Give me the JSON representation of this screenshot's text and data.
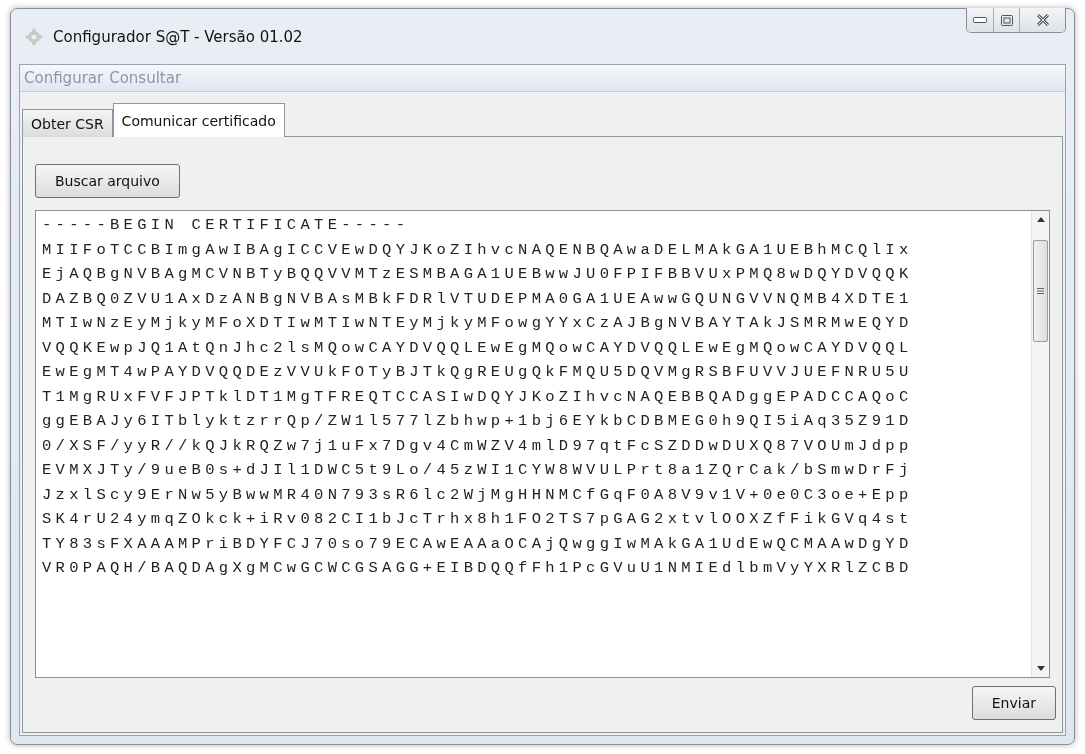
{
  "window": {
    "title": "Configurador S@T - Versão 01.02"
  },
  "menu": [
    {
      "label": "Configurar",
      "disabled": true
    },
    {
      "label": "Consultar",
      "disabled": true
    }
  ],
  "tabs": [
    {
      "label": "Obter CSR",
      "selected": false
    },
    {
      "label": "Comunicar certificado",
      "selected": true
    }
  ],
  "browse_button": "Buscar arquivo",
  "certificate_lines": [
    "-----BEGIN CERTIFICATE-----",
    "MIIFoTCCBImgAwIBAgICCVEwDQYJKoZIhvcNAQENBQAwaDELMAkGA1UEBhMCQlIx",
    "EjAQBgNVBAgMCVNBTyBQQVVMTzESMBAGA1UEBwwJU0FPIFBBVUxPMQ8wDQYDVQQK",
    "DAZBQ0ZVU1AxDzANBgNVBAsMBkFDRlVTUDEPMA0GA1UEAwwGQUNGVVNQMB4XDTE1",
    "MTIwNzEyMjkyMFoXDTIwMTIwNTEyMjkyMFowgYYxCzAJBgNVBAYTAkJSMRMwEQYD",
    "VQQKEwpJQ1AtQnJhc2lsMQowCAYDVQQLEwEgMQowCAYDVQQLEwEgMQowCAYDVQQL",
    "EwEgMT4wPAYDVQQDEzVVUkFOTyBJTkQgREUgQkFMQU5DQVMgRSBFUVVJUEFNRU5U",
    "T1MgRUxFVFJPTklDT1MgTFREQTCCASIwDQYJKoZIhvcNAQEBBQADggEPADCCAQoC",
    "ggEBAJy6ITblyktzrrQp/ZW1l577lZbhwp+1bj6EYkbCDBMEG0h9QI5iAq35Z91D",
    "0/XSF/yyR//kQJkRQZw7j1uFx7Dgv4CmWZV4mlD97qtFcSZDDwDUXQ87VOUmJdpp",
    "EVMXJTy/9ueB0s+dJIl1DWC5t9Lo/45zWI1CYW8WVULPrt8a1ZQrCak/bSmwDrFj",
    "JzxlScy9ErNw5yBwwMR40N793sR6lc2WjMgHHNMCfGqF0A8V9v1V+0e0C3oe+Epp",
    "SK4rU24ymqZOkck+iRv082CI1bJcTrhx8h1FO2TS7pGAG2xtvlOOXZfFikGVq4st",
    "TY83sFXAAAMPriBDYFCJ70so79ECAwEAAaOCAjQwggIwMAkGA1UdEwQCMAAwDgYD",
    "VR0PAQH/BAQDAgXgMCwGCWCGSAGG+EIBDQQfFh1PcGVuU1NMIEdlbmVyYXRlZCBD"
  ],
  "send_button": "Enviar"
}
